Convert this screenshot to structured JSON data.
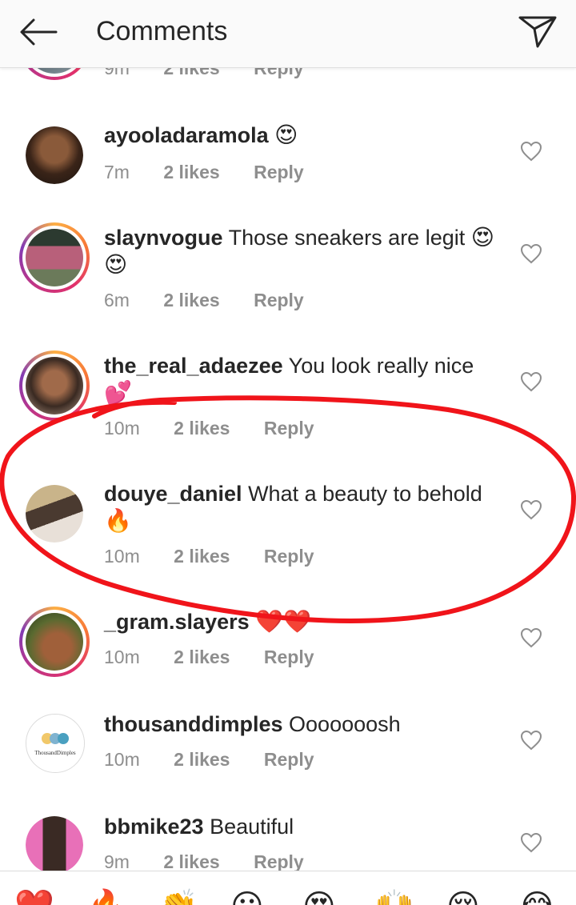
{
  "header": {
    "title": "Comments"
  },
  "partial_row": {
    "time": "9m",
    "likes": "2 likes",
    "reply": "Reply"
  },
  "comments": [
    {
      "username": "ayooladaramola",
      "text": "",
      "emoji": "😍",
      "time": "7m",
      "likes": "2 likes",
      "reply": "Reply"
    },
    {
      "username": "slaynvogue",
      "text": "Those sneakers are legit",
      "emoji": "😍 😍",
      "time": "6m",
      "likes": "2 likes",
      "reply": "Reply"
    },
    {
      "username": "the_real_adaezee",
      "text": "You look really nice",
      "emoji": "💕",
      "time": "10m",
      "likes": "2 likes",
      "reply": "Reply"
    },
    {
      "username": "douye_daniel",
      "text": "What a beauty to behold",
      "emoji": "🔥",
      "time": "10m",
      "likes": "2 likes",
      "reply": "Reply"
    },
    {
      "username": "_gram.slayers",
      "text": "",
      "emoji": "❤️❤️",
      "time": "10m",
      "likes": "2 likes",
      "reply": "Reply"
    },
    {
      "username": "thousanddimples",
      "text": "Ooooooosh",
      "emoji": "",
      "time": "10m",
      "likes": "2 likes",
      "reply": "Reply",
      "avatar_text": "ThousandDimples"
    },
    {
      "username": "bbmike23",
      "text": "Beautiful",
      "emoji": "",
      "time": "9m",
      "likes": "2 likes",
      "reply": "Reply"
    }
  ],
  "emoji_bar": [
    "❤️",
    "🔥",
    "👏",
    "😮",
    "😍",
    "🙌",
    "😢",
    "😂"
  ]
}
